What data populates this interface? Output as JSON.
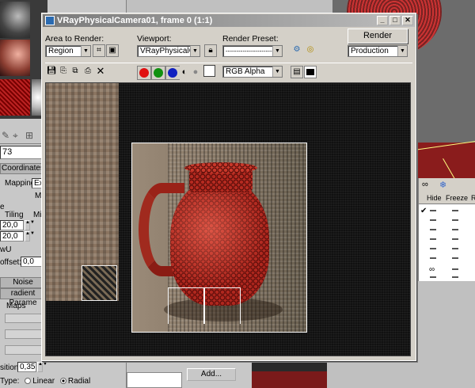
{
  "window": {
    "title": "VRayPhysicalCamera01, frame 0 (1:1)",
    "area_label": "Area to Render:",
    "area_value": "Region",
    "viewport_label": "Viewport:",
    "viewport_value": "VRayPhysicalCam",
    "preset_label": "Render Preset:",
    "preset_value": "-------------------------",
    "render_button": "Render",
    "production_value": "Production",
    "channel_value": "RGB Alpha"
  },
  "material_editor": {
    "field_value": "73",
    "coordinates_label": "Coordinates",
    "mapping_label": "Mapping:",
    "mapping_value": "Ex",
    "m_label": "M",
    "e_label": "e",
    "tiling_label": "Tiling",
    "mi_label": "Mi",
    "tiling_u": "20,0",
    "tiling_v": "20,0",
    "wu_label": "wU",
    "offset_label": "offset:",
    "offset_value": "0,0",
    "noise_label": "Noise",
    "gradient_label": "radient Parame",
    "maps_label": "Maps",
    "position_label": "sition:",
    "position_value": "0,35",
    "type_label": "Type:",
    "type_linear": "Linear",
    "type_radial": "Radial"
  },
  "add_button": "Add...",
  "layer_manager": {
    "col_hide": "Hide",
    "col_freeze": "Freeze",
    "col_r": "R"
  }
}
